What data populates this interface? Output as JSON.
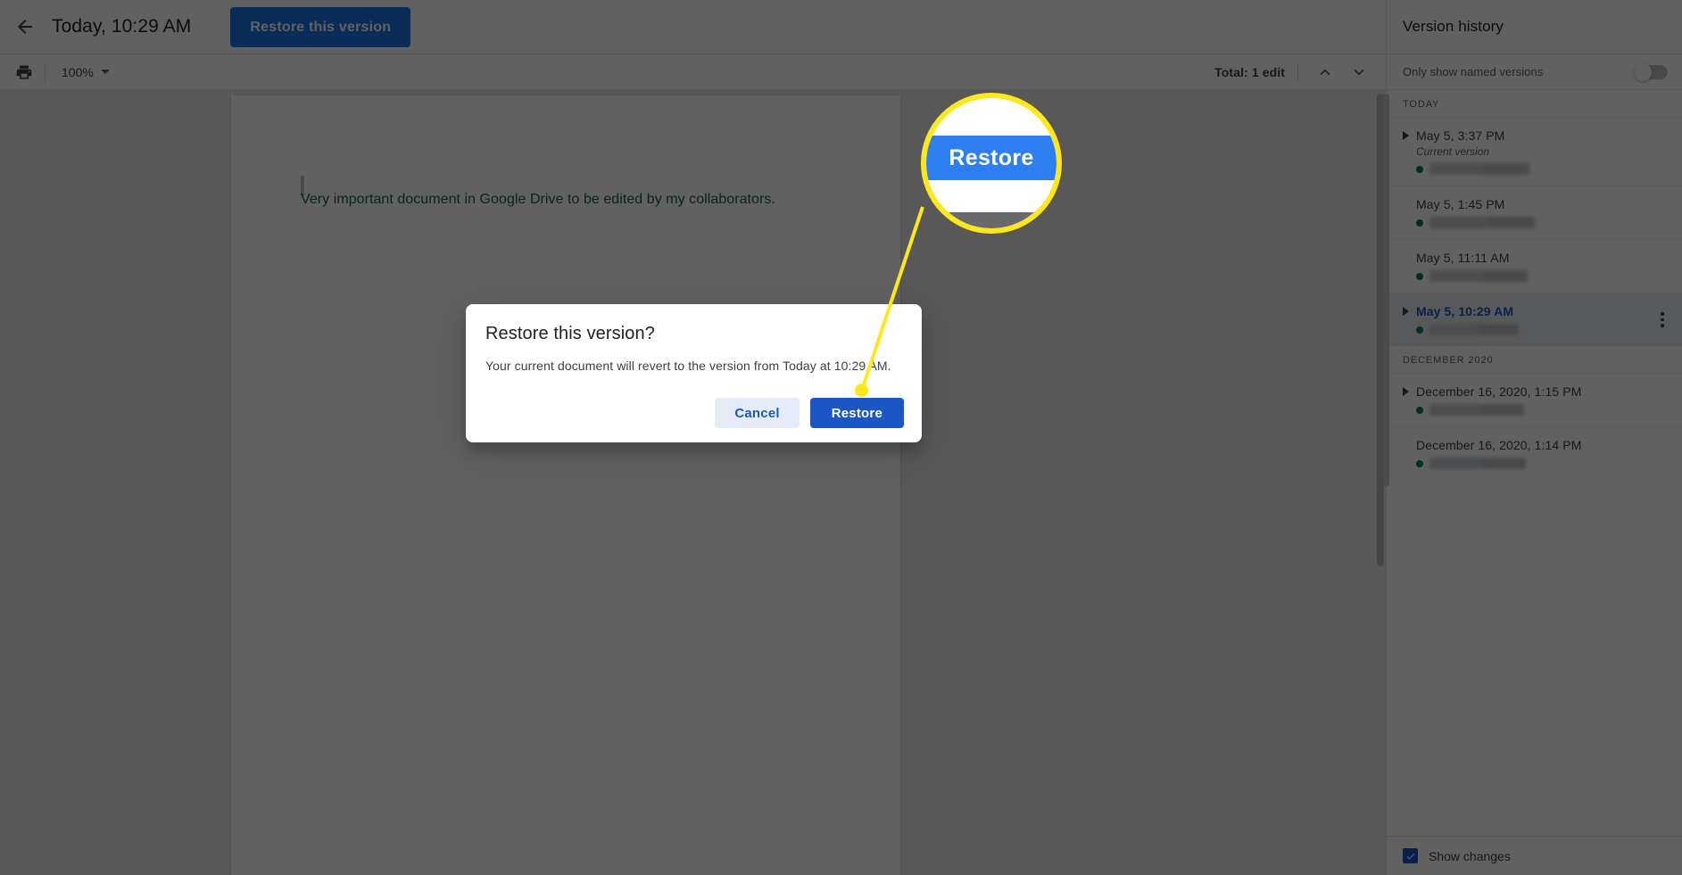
{
  "topbar": {
    "back_icon": "arrow-left-icon",
    "doc_title": "Today, 10:29 AM",
    "restore_version_label": "Restore this version"
  },
  "subbar": {
    "print_icon": "printer-icon",
    "zoom_value": "100%",
    "zoom_caret_icon": "chevron-down-icon",
    "total_edits": "Total: 1 edit",
    "prev_icon": "chevron-up-icon",
    "next_icon": "chevron-down-icon"
  },
  "document": {
    "body_text": "Very important document in Google Drive to be edited by my collaborators.",
    "text_color": "#1d5c52"
  },
  "sidebar": {
    "title": "Version history",
    "named_versions_label": "Only show named versions",
    "named_versions_on": false,
    "footer_label": "Show changes",
    "footer_checked": true,
    "groups": [
      {
        "label": "TODAY",
        "items": [
          {
            "date": "May 5, 3:37 PM",
            "subtitle": "Current version",
            "expandable": true,
            "selected": false,
            "author_blur_width": 112,
            "kebab": false
          },
          {
            "date": "May 5, 1:45 PM",
            "subtitle": "",
            "expandable": false,
            "selected": false,
            "author_blur_width": 118,
            "kebab": false
          },
          {
            "date": "May 5, 11:11 AM",
            "subtitle": "",
            "expandable": false,
            "selected": false,
            "author_blur_width": 110,
            "kebab": false
          },
          {
            "date": "May 5, 10:29 AM",
            "subtitle": "",
            "expandable": true,
            "selected": true,
            "author_blur_width": 100,
            "kebab": true
          }
        ]
      },
      {
        "label": "DECEMBER 2020",
        "items": [
          {
            "date": "December 16, 2020, 1:15 PM",
            "subtitle": "",
            "expandable": true,
            "selected": false,
            "author_blur_width": 106,
            "kebab": false
          },
          {
            "date": "December 16, 2020, 1:14 PM",
            "subtitle": "",
            "expandable": false,
            "selected": false,
            "author_blur_width": 108,
            "kebab": false
          }
        ]
      }
    ]
  },
  "dialog": {
    "title": "Restore this version?",
    "message": "Your current document will revert to the version from Today at 10:29 AM.",
    "cancel_label": "Cancel",
    "restore_label": "Restore"
  },
  "callout": {
    "magnified_label": "Restore",
    "highlight_color": "#ffe81a"
  },
  "colors": {
    "accent_blue": "#1a73e8",
    "dialog_blue": "#1a56c4",
    "magnifier_blue": "#2d7ef0",
    "status_dot_green": "#0b7a63",
    "highlight_yellow": "#ffe81a"
  }
}
